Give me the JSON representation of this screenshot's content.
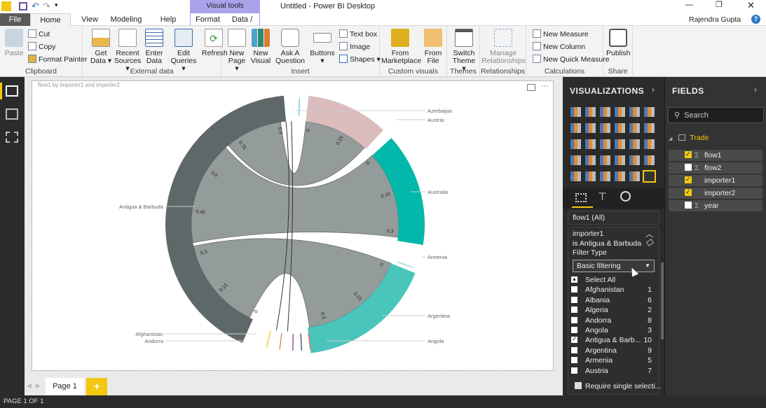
{
  "window": {
    "title": "Untitled - Power BI Desktop",
    "user": "Rajendra Gupta",
    "contextual_group": "Visual tools"
  },
  "tabs": [
    "File",
    "Home",
    "View",
    "Modeling",
    "Help",
    "Format",
    "Data / Drill"
  ],
  "ribbon": {
    "clipboard": {
      "label": "Clipboard",
      "paste": "Paste",
      "cut": "Cut",
      "copy": "Copy",
      "format_painter": "Format Painter"
    },
    "external_data": {
      "label": "External data",
      "get_data": "Get Data ▾",
      "recent_sources": "Recent Sources ▾",
      "enter_data": "Enter Data",
      "edit_queries": "Edit Queries ▾",
      "refresh": "Refresh"
    },
    "insert": {
      "label": "Insert",
      "new_page": "New Page ▾",
      "new_visual": "New Visual",
      "ask_question": "Ask A Question",
      "buttons": "Buttons ▾",
      "text_box": "Text box",
      "image": "Image",
      "shapes": "Shapes ▾"
    },
    "custom_visuals": {
      "label": "Custom visuals",
      "from_marketplace": "From Marketplace",
      "from_file": "From File"
    },
    "themes": {
      "label": "Themes",
      "switch_theme": "Switch Theme ▾"
    },
    "relationships": {
      "label": "Relationships",
      "manage": "Manage Relationships"
    },
    "calculations": {
      "label": "Calculations",
      "new_measure": "New Measure",
      "new_column": "New Column",
      "new_quick_measure": "New Quick Measure"
    },
    "share": {
      "label": "Share",
      "publish": "Publish"
    }
  },
  "visual": {
    "title": "flow1 by importer1 and importer2",
    "more": "···"
  },
  "chart_data": {
    "type": "chord",
    "title": "flow1 by importer1 and importer2",
    "groups": [
      {
        "name": "Antigua & Barbuda",
        "color": "#5f6869",
        "ticks": [
          "0",
          "0.15",
          "0.3",
          "0.45",
          "0.6",
          "0.75",
          "0.9"
        ]
      },
      {
        "name": "Austria",
        "color": "#dbbcbd",
        "ticks": [
          "0",
          "0.15"
        ]
      },
      {
        "name": "Australia",
        "color": "#01b8aa",
        "ticks": [
          "0",
          "0.15",
          "0.3"
        ]
      },
      {
        "name": "Argentina",
        "color": "#4ac5bb",
        "ticks": [
          "0",
          "0.15",
          "0.3"
        ]
      },
      {
        "name": "Angola",
        "color": "#4ac5bb",
        "ticks": []
      },
      {
        "name": "Armenia",
        "color": "#8ad4eb",
        "ticks": []
      },
      {
        "name": "Azerbaijan",
        "color": "#5bc0de",
        "ticks": []
      },
      {
        "name": "Afghanistan",
        "color": "#f2c80f",
        "ticks": []
      },
      {
        "name": "Andorra",
        "color": "#fd625e",
        "ticks": []
      }
    ]
  },
  "pages": {
    "tab": "Page 1",
    "add": "+",
    "status": "PAGE 1 OF 1"
  },
  "visualizations": {
    "title": "VISUALIZATIONS",
    "more": "···"
  },
  "filters": {
    "flow1": "flow1  (All)",
    "card_title": "importer1",
    "condition": "is Antigua & Barbuda",
    "filter_type_label": "Filter Type",
    "filter_type": "Basic filtering",
    "select_all": "Select All",
    "items": [
      {
        "name": "Afghanistan",
        "count": "1",
        "checked": false
      },
      {
        "name": "Albania",
        "count": "6",
        "checked": false
      },
      {
        "name": "Algeria",
        "count": "2",
        "checked": false
      },
      {
        "name": "Andorra",
        "count": "8",
        "checked": false
      },
      {
        "name": "Angola",
        "count": "3",
        "checked": false
      },
      {
        "name": "Antigua & Barb...",
        "count": "10",
        "checked": true
      },
      {
        "name": "Argentina",
        "count": "9",
        "checked": false
      },
      {
        "name": "Armenia",
        "count": "5",
        "checked": false
      },
      {
        "name": "Austria",
        "count": "7",
        "checked": false
      }
    ],
    "require_single": "Require single selecti..."
  },
  "fields": {
    "title": "FIELDS",
    "search_placeholder": "Search",
    "table": "Trade",
    "items": [
      {
        "name": "flow1",
        "sigma": true,
        "checked": true
      },
      {
        "name": "flow2",
        "sigma": true,
        "checked": false
      },
      {
        "name": "importer1",
        "sigma": false,
        "checked": true
      },
      {
        "name": "importer2",
        "sigma": false,
        "checked": true
      },
      {
        "name": "year",
        "sigma": true,
        "checked": false
      }
    ]
  }
}
